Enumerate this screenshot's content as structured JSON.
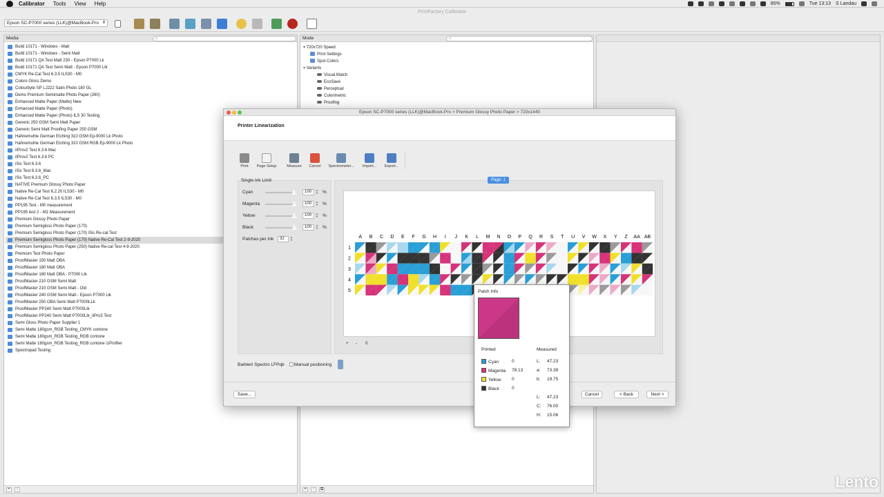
{
  "menubar": {
    "items": [
      "Calibrator",
      "Tools",
      "View",
      "Help"
    ],
    "battery": "85%",
    "time": "Tue 13:13",
    "user": "S Landau"
  },
  "window_title": "PrintFactory Calibrator",
  "toolbar": {
    "device": "Epson SC-P7000 series (LLK)@MacBook-Pro"
  },
  "media_panel": {
    "header": "Media",
    "selected_index": 28,
    "items": [
      "Build 10171 - Windows - Matt",
      "Build 10171 - Windows - Semi Matt",
      "Build 10171 QA Test Matt 230 - Epson P7000 Lk",
      "Build 10171 QA Test Semi Matt - Epson P7000 Llk",
      "CMYK Re-Cal Test 6.3.5 ILS30 - M0",
      "Coloro Gloss Demo",
      "Colourbyte SP LJ222 Satin Photo 180 GL",
      "Demo Premium Semimatte Photo Paper (260)",
      "Enhanced Matte Paper (Matte) New",
      "Enhanced Matte Paper (Photo)",
      "Enhanced Matte Paper (Photo) ILS 30 Testing",
      "Generic 250 GSM Semi Matt Paper",
      "Generic Semi Matt Proofing Paper 250 GSM",
      "Hahnemuhle German Etching 310 GSM Ep-9000 Lk Photo",
      "Hahnemuhle German Etching 310 GSM RGB Ep-9000 Lk Photo",
      "iIProv2 Test 6.3.6 Mac",
      "iIProv2 Test 6.3.6 PC",
      "iSis Test 6.3.6",
      "iSis Test 6.3.6_Mac",
      "iSis Test 6.3.6_PC",
      "NATIVE Premium Glossy Photo Paper",
      "Native Re-Cal Test 6.2.20 ILS30 - M0",
      "Native Re-Cal Test 6.3.5 ILS30 - M0",
      "PP195 Test - M0 measurement",
      "PP195 test 2 - M1 Measurement",
      "Premium Glossy Photo Paper",
      "Premium Semigloss Photo Paper (170)",
      "Premium Semigloss Photo Paper (170) iSis Re-cal Test",
      "Premium Semigloss Photo Paper (170) Native Re-Cal Test 2-9-2020",
      "Premium Semigloss Photo Paper (250) Native Re-cal Test 4-9-2020",
      "Premium Test Photo Paper",
      "ProofMaster 150 Matt OBA",
      "ProofMaster 180 Matt OBA",
      "ProofMaster 180 Matt OBA - P7000 Llk",
      "ProofMaster 210 GSM Semi Matt",
      "ProofMaster 210 GSM Semi Matt - Old",
      "ProofMaster 240 GSM Semi Matt - Epson P7000 Llk",
      "ProofMaster 250 OBA Semi Matt P7000LLk",
      "ProofMaster PP240 Semi Matt P7000Llk",
      "ProofMaster PP240 Semi Matt P7000Llk_iIPro3 Test",
      "Semi Gloss Photo Paper Supplier 1",
      "Semi Matte 180gsm_RGB Testing_CMYK contone",
      "Semi Matte 180gsm_RGB Testing_RGB contone",
      "Semi Matte 180gsm_RGB Testing_RGB contone i1Profiler",
      "Spectropad Testing"
    ]
  },
  "mode_panel": {
    "header": "Mode",
    "tree": [
      {
        "label": "720x720 Speed",
        "level": 0,
        "expander": true,
        "icon": "none"
      },
      {
        "label": "Print Settings",
        "level": 1,
        "icon": "doc"
      },
      {
        "label": "Spot Colors",
        "level": 1,
        "icon": "doc"
      },
      {
        "label": "Variants",
        "level": 0,
        "expander": true,
        "icon": "none"
      },
      {
        "label": "Visual Match",
        "level": 2,
        "icon": "eye"
      },
      {
        "label": "EcoSave",
        "level": 2,
        "icon": "eye"
      },
      {
        "label": "Perceptual",
        "level": 2,
        "icon": "eye"
      },
      {
        "label": "Colorimetric",
        "level": 2,
        "icon": "eye"
      },
      {
        "label": "Proofing",
        "level": 2,
        "icon": "eye"
      }
    ]
  },
  "dialog": {
    "title": "Epson SC-P7000 series (LLK)@MacBook-Pro > Premium Glossy Photo Paper > 720x1440",
    "heading": "Printer Linearization",
    "tools": [
      "Print",
      "Page Setup",
      "Measure",
      "Cancel",
      "Spectrometer...",
      "Import...",
      "Export..."
    ],
    "single_ink_limit": {
      "title": "Single Ink Limit",
      "inks": [
        {
          "name": "Cyan",
          "value": "100"
        },
        {
          "name": "Magenta",
          "value": "100"
        },
        {
          "name": "Yellow",
          "value": "100"
        },
        {
          "name": "Black",
          "value": "100"
        }
      ],
      "percent": "%",
      "patches_label": "Patches per Ink",
      "patches_value": "32"
    },
    "page_badge": "Page: 1",
    "chart_footer": [
      "+",
      "-",
      "0"
    ],
    "device_label": "Barbieri Spectro LFPqb",
    "manual_positioning": "Manual positioning",
    "buttons": {
      "save": "Save...",
      "cancel": "Cancel",
      "back": "< Back",
      "next": "Next >"
    }
  },
  "target": {
    "columns": [
      "A",
      "B",
      "C",
      "D",
      "E",
      "F",
      "G",
      "H",
      "I",
      "J",
      "K",
      "L",
      "M",
      "N",
      "O",
      "P",
      "Q",
      "R",
      "S",
      "T",
      "U",
      "V",
      "W",
      "X",
      "Y",
      "Z",
      "AA",
      "AB"
    ],
    "rows": [
      "1",
      "2",
      "3",
      "4",
      "5"
    ],
    "colors": {
      "C": "#2a9fd6",
      "M": "#d6337a",
      "Y": "#f0e02a",
      "K": "#333333",
      "c": "#a8d8ef",
      "m": "#ecaac8",
      "y": "#f7f1a6",
      "k": "#9a9a9a",
      "W": "#f7f7f7"
    },
    "patches": [
      [
        "CW",
        "KK",
        "kW",
        "cW",
        "cc",
        "CC",
        "CW",
        "CC",
        "YW",
        "WW",
        "MW",
        "KW",
        "MM",
        "MK",
        "Cc",
        "CW",
        "mW",
        "MW",
        "mW",
        "WW",
        "CW",
        "YW",
        "KW",
        "KK",
        "kW",
        "MW",
        "MM",
        "kW"
      ],
      [
        "YW",
        "Mm",
        "KW",
        "CW",
        "KK",
        "KK",
        "KK",
        "kW",
        "MM",
        "WW",
        "Cc",
        "KK",
        "MW",
        "KW",
        "CC",
        "MW",
        "YY",
        "MW",
        "kW",
        "WW",
        "YW",
        "KW",
        "mW",
        "MM",
        "YW",
        "CC",
        "KK",
        "KW"
      ],
      [
        "cW",
        "Mm",
        "YW",
        "MM",
        "CC",
        "CC",
        "CC",
        "KK",
        "WW",
        "MW",
        "CW",
        "KK",
        "kW",
        "KW",
        "CC",
        "MW",
        "kW",
        "MW",
        "cW",
        "WW",
        "KW",
        "CW",
        "MW",
        "mW",
        "CW",
        "cW",
        "YW",
        "KK"
      ],
      [
        "CW",
        "YY",
        "YY",
        "CC",
        "MM",
        "YY",
        "cW",
        "CC",
        "MW",
        "KW",
        "kW",
        "KW",
        "YW",
        "KW",
        "CW",
        "kW",
        "CW",
        "kW",
        "KW",
        "KW",
        "YY",
        "YY",
        "MW",
        "mW",
        "CW",
        "MW",
        "YW",
        "MW"
      ],
      [
        "YW",
        "MM",
        "MW",
        "cW",
        "CW",
        "YW",
        "YW",
        "YW",
        "MM",
        "CC",
        "CC",
        "KW",
        "kW",
        "mW",
        "cW",
        "kW",
        "kW",
        "MW",
        "mW",
        "kW",
        "kW",
        "yW",
        "mW",
        "kW",
        "mW",
        "kW",
        "cW",
        "WW"
      ]
    ]
  },
  "patch_info": {
    "title": "Patch Info",
    "swatch_color": "#cc3888",
    "printed_label": "Printed",
    "measured_label": "Measured",
    "printed": [
      {
        "name": "Cyan",
        "value": "0",
        "color": "#2a9fd6"
      },
      {
        "name": "Magenta",
        "value": "78.13",
        "color": "#d6337a"
      },
      {
        "name": "Yellow",
        "value": "0",
        "color": "#f0e02a"
      },
      {
        "name": "Black",
        "value": "0",
        "color": "#333333"
      }
    ],
    "measured_lab": [
      {
        "k": "L:",
        "v": "47.23"
      },
      {
        "k": "a:",
        "v": "73.39"
      },
      {
        "k": "b:",
        "v": "19.75"
      }
    ],
    "measured_lch": [
      {
        "k": "L:",
        "v": "47.23"
      },
      {
        "k": "C:",
        "v": "76.00"
      },
      {
        "k": "H:",
        "v": "15.06"
      }
    ]
  },
  "watermark": "Lento"
}
